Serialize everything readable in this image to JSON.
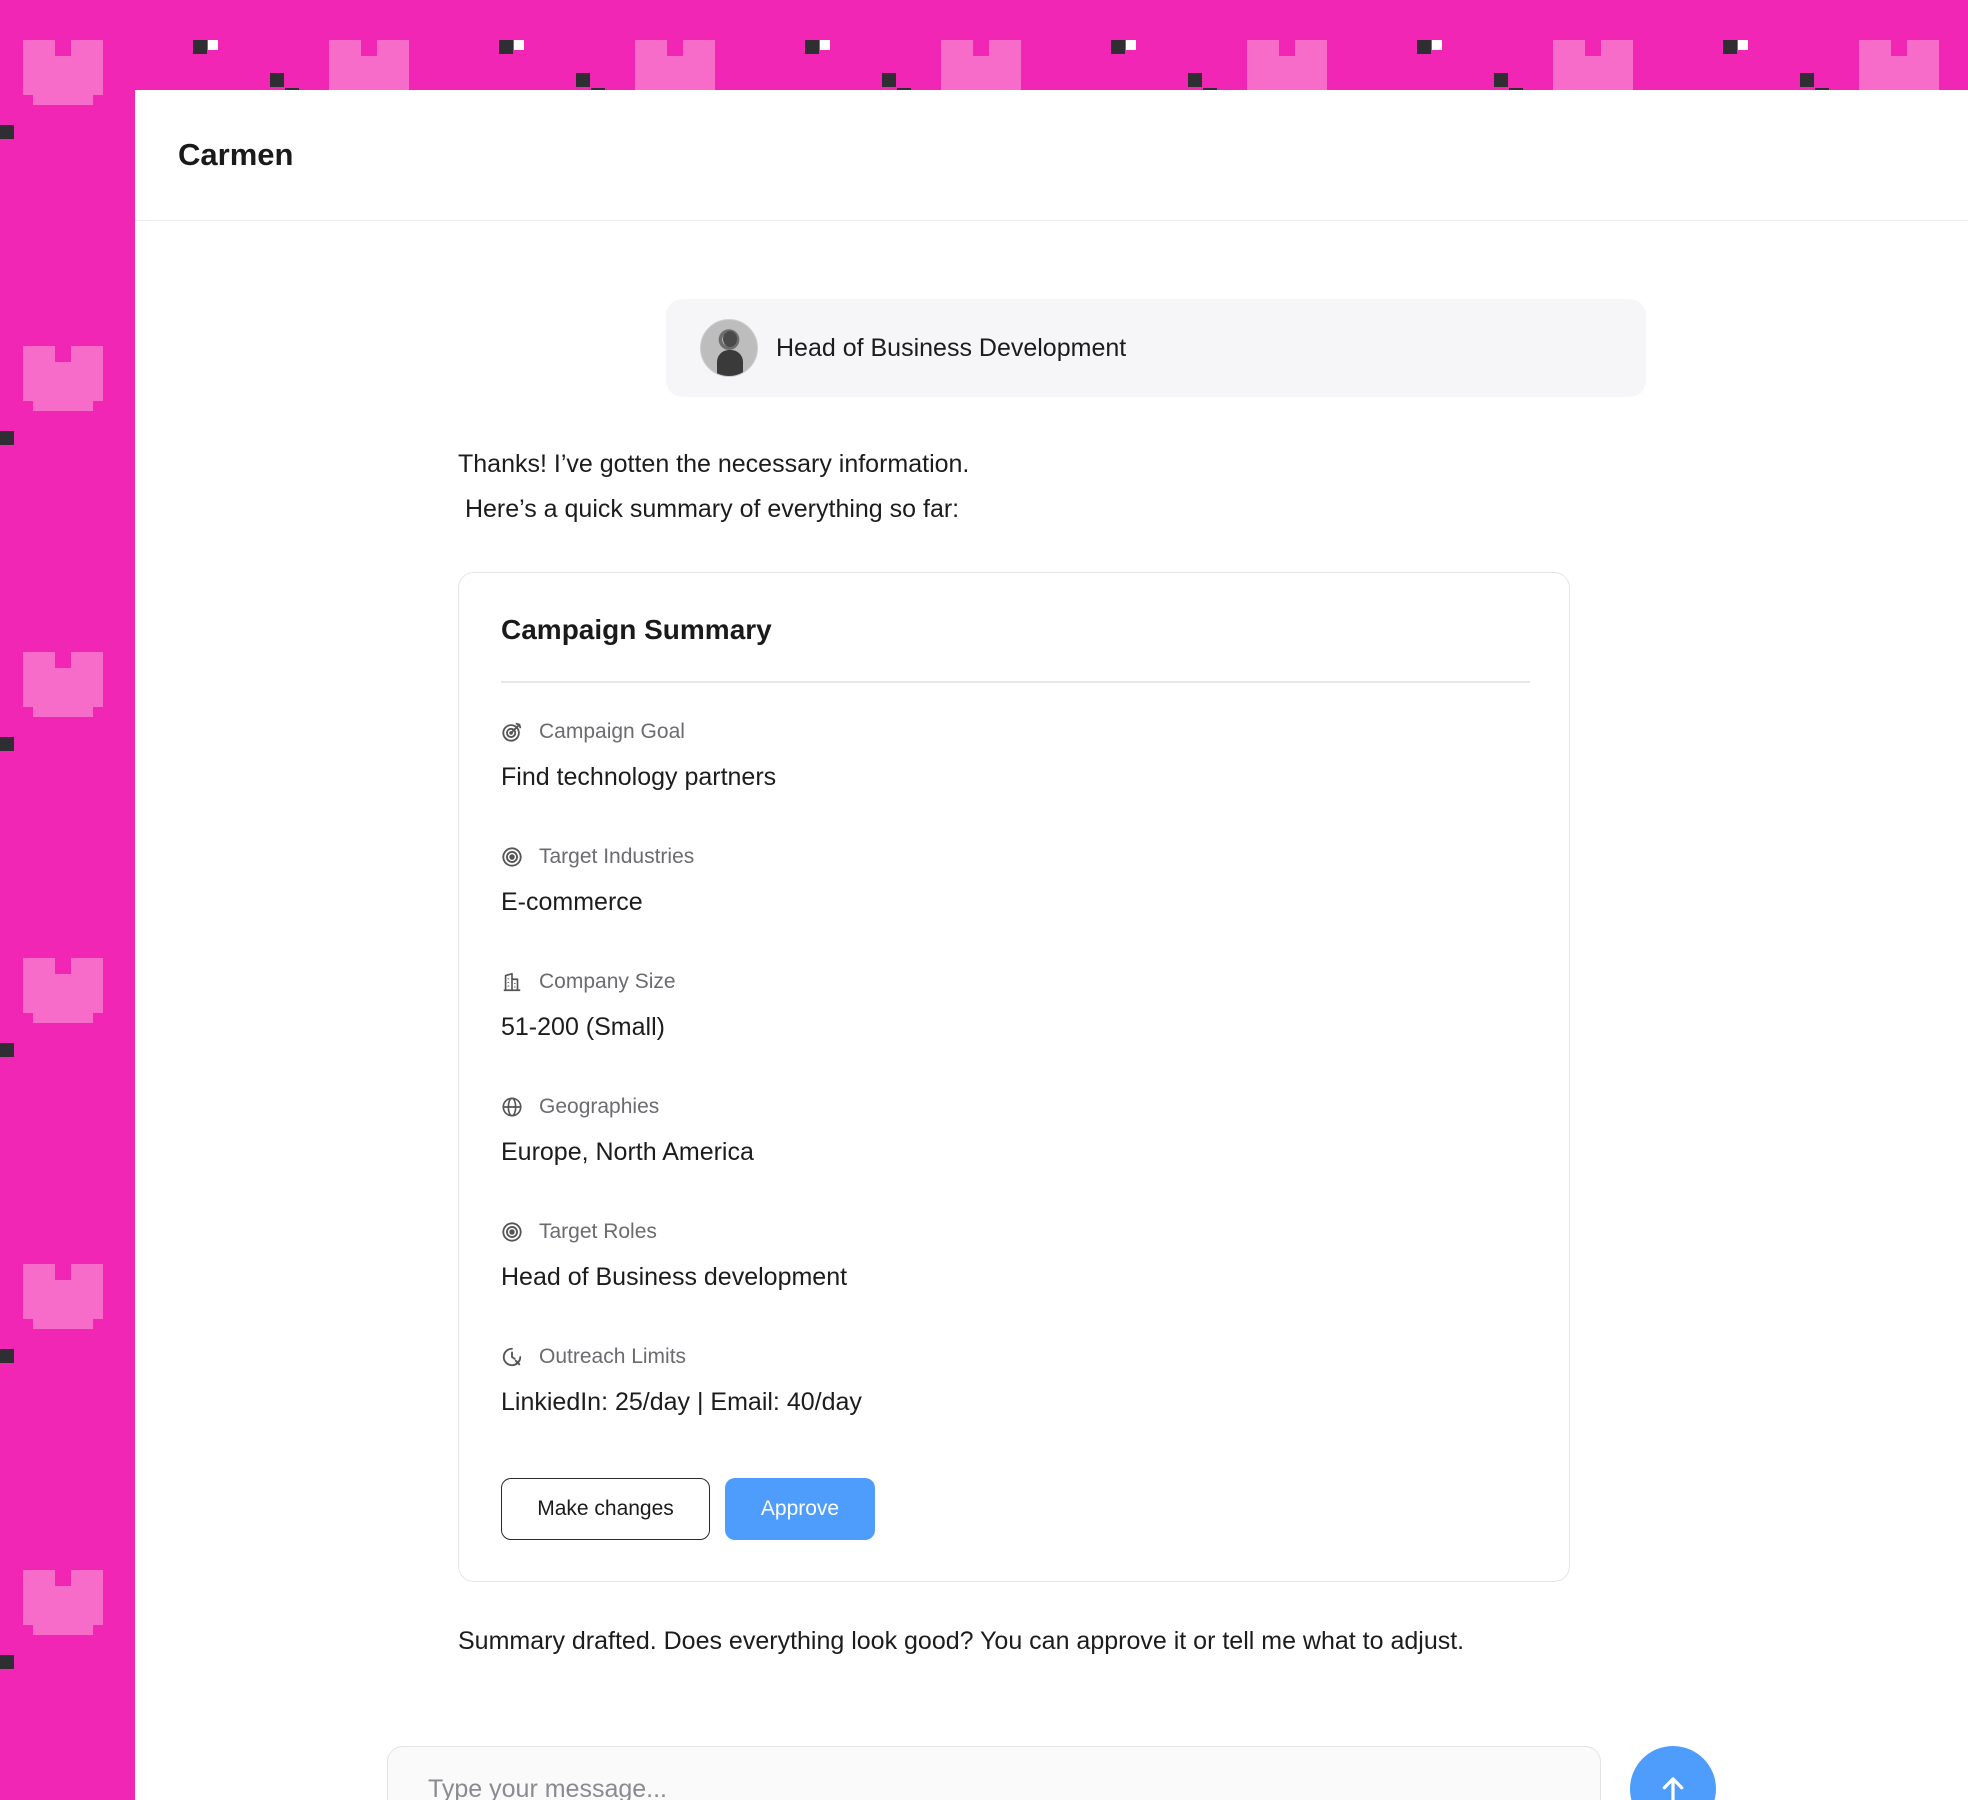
{
  "app": {
    "title": "Carmen",
    "background_color": "#f226b5",
    "accent_color": "#4e9cfb"
  },
  "user_message": {
    "avatar_icon": "user-avatar",
    "text": "Head of Business Development"
  },
  "assistant_intro": {
    "line1": "Thanks! I’ve gotten the necessary information.",
    "line2": " Here’s a quick summary of everything so far:"
  },
  "summary_card": {
    "title": "Campaign Summary",
    "fields": [
      {
        "icon": "target-arrow-icon",
        "label": "Campaign Goal",
        "value": "Find technology partners"
      },
      {
        "icon": "target-icon",
        "label": "Target Industries",
        "value": "E-commerce"
      },
      {
        "icon": "building-icon",
        "label": "Company Size",
        "value": "51-200 (Small)"
      },
      {
        "icon": "globe-icon",
        "label": "Geographies",
        "value": "Europe, North America"
      },
      {
        "icon": "target-icon",
        "label": "Target Roles",
        "value": "Head of Business development"
      },
      {
        "icon": "clock-icon",
        "label": "Outreach Limits",
        "value": "LinkiedIn: 25/day | Email: 40/day"
      }
    ],
    "make_changes_label": "Make changes",
    "approve_label": "Approve"
  },
  "assistant_followup": "Summary drafted. Does everything look good? You can approve it or tell me what to adjust.",
  "composer": {
    "placeholder": "Type your message...",
    "value": "",
    "send_icon": "arrow-up-icon"
  }
}
